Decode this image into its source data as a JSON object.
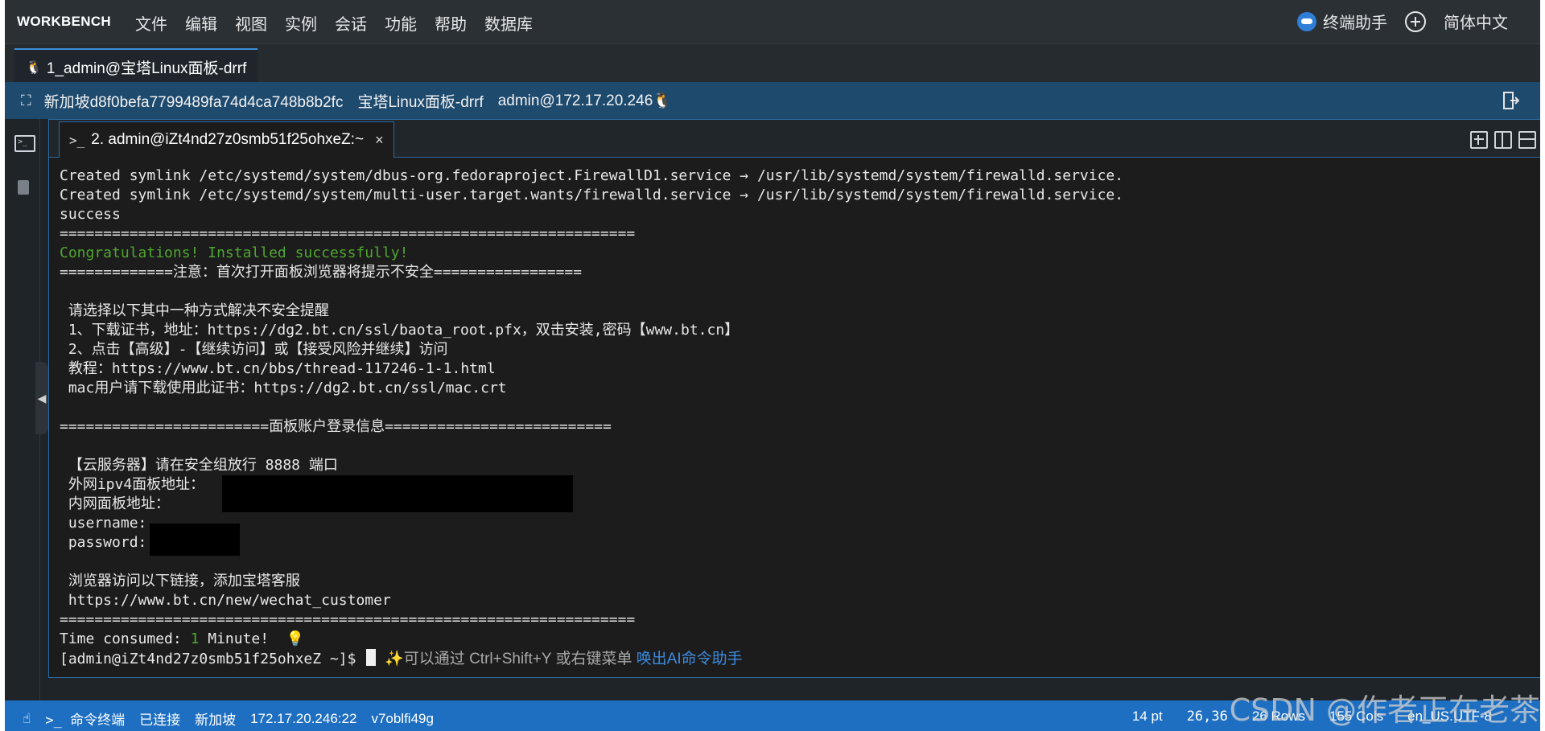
{
  "app": {
    "brand": "WORKBENCH"
  },
  "menu": {
    "items": [
      "文件",
      "编辑",
      "视图",
      "实例",
      "会话",
      "功能",
      "帮助",
      "数据库"
    ]
  },
  "topright": {
    "assistant_label": "终端助手",
    "language": "简体中文"
  },
  "session_tab": {
    "label": "1_admin@宝塔Linux面板-drrf",
    "icon": "linux-icon"
  },
  "infobar": {
    "instance_id": "新加坡d8f0befa7799489fa74d4ca748b8b2fc",
    "instance_name": "宝塔Linux面板-drrf",
    "login": "admin@172.17.20.246"
  },
  "terminal_tab": {
    "prompt": ">_",
    "label": "2. admin@iZt4nd27z0smb51f25ohxeZ:~",
    "close": "×"
  },
  "terminal": {
    "lines": [
      "Created symlink /etc/systemd/system/dbus-org.fedoraproject.FirewallD1.service → /usr/lib/systemd/system/firewalld.service.",
      "Created symlink /etc/systemd/system/multi-user.target.wants/firewalld.service → /usr/lib/systemd/system/firewalld.service.",
      "success",
      "==================================================================",
      "Congratulations! Installed successfully!",
      "=============注意：首次打开面板浏览器将提示不安全=================",
      "",
      " 请选择以下其中一种方式解决不安全提醒",
      " 1、下载证书，地址：https://dg2.bt.cn/ssl/baota_root.pfx，双击安装,密码【www.bt.cn】",
      " 2、点击【高级】-【继续访问】或【接受风险并继续】访问",
      " 教程：https://www.bt.cn/bbs/thread-117246-1-1.html",
      " mac用户请下载使用此证书：https://dg2.bt.cn/ssl/mac.crt",
      "",
      "========================面板账户登录信息==========================",
      "",
      " 【云服务器】请在安全组放行 8888 端口",
      " 外网ipv4面板地址：",
      " 内网面板地址：",
      " username:",
      " password:",
      "",
      " 浏览器访问以下链接，添加宝塔客服",
      " https://www.bt.cn/new/wechat_customer",
      "==================================================================",
      "Time consumed: ",
      "[admin@iZt4nd27z0smb51f25ohxeZ ~]$ "
    ],
    "time_value": "1",
    "time_unit": " Minute!",
    "hint": "✨可以通过 Ctrl+Shift+Y 或右键菜单 ",
    "hint_link": "唤出AI命令助手"
  },
  "statusbar": {
    "terminal_label": "命令终端",
    "connection": "已连接",
    "region": "新加坡",
    "address": "172.17.20.246:22",
    "session_id": "v7oblfi49g",
    "font_size": "14 pt",
    "cursor_pos": "26,36",
    "rows": "26 Rows",
    "cols": "155 Cols",
    "encoding": "en_US.UTF-8"
  },
  "watermark": "CSDN @作者正在老茶",
  "colors": {
    "statusbar": "#1e6fc2",
    "infobar": "#1e4a6e",
    "success_green": "#4ea62f",
    "hint_link": "#3c8ce0"
  }
}
